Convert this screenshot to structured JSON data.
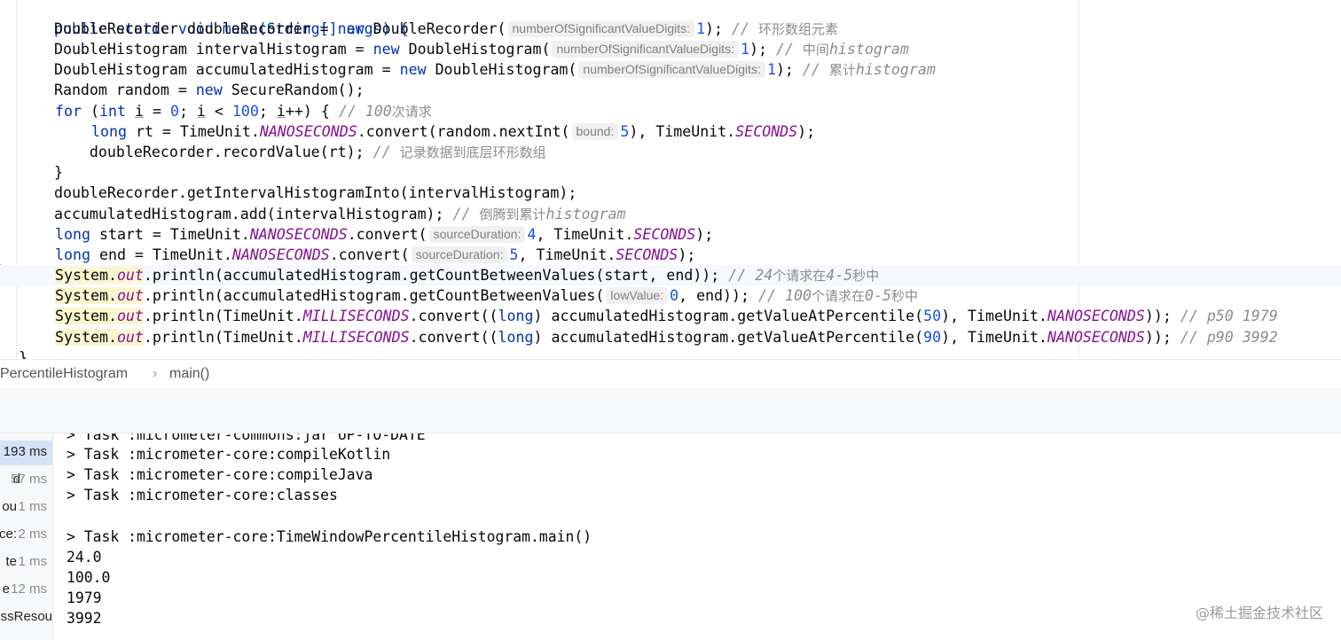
{
  "editor": {
    "lines": [
      {
        "text": "public static void main(String[] args) {"
      },
      {
        "a": "    DoubleRecorder doubleRecorder = ",
        "kw": "new",
        "b": " DoubleRecorder(",
        "hint": "numberOfSignificantValueDigits:",
        "num": "1",
        "c": ");",
        "cmt": " // ",
        "cjk": "环形数组元素"
      },
      {
        "a": "    DoubleHistogram intervalHistogram = ",
        "kw": "new",
        "b": " DoubleHistogram(",
        "hint": "numberOfSignificantValueDigits:",
        "num": "1",
        "c": ");",
        "cmt": " // ",
        "cjk": "中间",
        "cmt2": "histogram"
      },
      {
        "a": "    DoubleHistogram accumulatedHistogram = ",
        "kw": "new",
        "b": " DoubleHistogram(",
        "hint": "numberOfSignificantValueDigits:",
        "num": "1",
        "c": ");",
        "cmt": " // ",
        "cjk": "累计",
        "cmt2": "histogram"
      },
      {
        "a": "    Random random = ",
        "kw": "new",
        "b": " SecureRandom();"
      },
      {
        "kw1": "for",
        "a": " (",
        "kw2": "int",
        "b": " ",
        "u1": "i",
        "c": " = ",
        "num1": "0",
        "d": "; ",
        "u2": "i",
        "e": " < ",
        "num2": "100",
        "f": "; ",
        "u3": "i",
        "g": "++) { ",
        "cmt": "// 100",
        "cjk": "次请求"
      },
      {
        "kw": "long",
        "a": " rt = TimeUnit.",
        "field": "NANOSECONDS",
        "b": ".convert(random.nextInt(",
        "hint": "bound:",
        "num": "5",
        "c": "), TimeUnit.",
        "field2": "SECONDS",
        "d": ");"
      },
      {
        "a": "        doubleRecorder.recordValue(rt); ",
        "cmt": "// ",
        "cjk": "记录数据到底层环形数组"
      },
      {
        "a": "    }"
      },
      {
        "a": "    doubleRecorder.getIntervalHistogramInto(intervalHistogram);"
      },
      {
        "a": "    accumulatedHistogram.add(intervalHistogram); ",
        "cmt": "// ",
        "cjk": "倒腾到累计",
        "cmt2": "histogram"
      },
      {
        "kw": "long",
        "a": " start = TimeUnit.",
        "field": "NANOSECONDS",
        "b": ".convert(",
        "hint": "sourceDuration:",
        "num": "4",
        "c": ", TimeUnit.",
        "field2": "SECONDS",
        "d": ");"
      },
      {
        "kw": "long",
        "a": " end = TimeUnit.",
        "field": "NANOSECONDS",
        "b": ".convert(",
        "hint": "sourceDuration:",
        "num": "5",
        "c": ", TimeUnit.",
        "field2": "SECONDS",
        "d": ");"
      },
      {
        "sys": "System.",
        "out": "out",
        "a": ".println(accumulatedHistogram.getCountBetweenValues(start, end)); ",
        "cmt": "// 24",
        "cjk": "个请求在",
        "cmt2": "4-5",
        "cjk2": "秒中"
      },
      {
        "sys": "System.",
        "out": "out",
        "a": ".println(accumulatedHistogram.getCountBetweenValues(",
        "hint": "lowValue:",
        "num": "0",
        "b": ", end)); ",
        "cmt": "// 100",
        "cjk": "个请求在",
        "cmt2": "0-5",
        "cjk2": "秒中"
      },
      {
        "sys": "System.",
        "out": "out",
        "a": ".println(TimeUnit.",
        "field": "MILLISECONDS",
        "b": ".convert((",
        "kw": "long",
        "c": ") accumulatedHistogram.getValueAtPercentile(",
        "num": "50",
        "d": "), TimeUnit.",
        "field2": "NANOSECONDS",
        "e": ")); ",
        "cmt": "// p50 1979"
      },
      {
        "sys": "System.",
        "out": "out",
        "a": ".println(TimeUnit.",
        "field": "MILLISECONDS",
        "b": ".convert((",
        "kw": "long",
        "c": ") accumulatedHistogram.getValueAtPercentile(",
        "num": "90",
        "d": "), TimeUnit.",
        "field2": "NANOSECONDS",
        "e": ")); ",
        "cmt": "// p90 3992"
      }
    ],
    "closing_brace": "}"
  },
  "breadcrumb": {
    "class_name": "PercentileHistogram",
    "separator": "›",
    "method": "main()"
  },
  "build_tree": [
    {
      "name": "",
      "time": "193 ms",
      "selected": true
    },
    {
      "name": "d",
      "time": "57 ms",
      "selected": false
    },
    {
      "name": "ou",
      "time": "1 ms",
      "selected": false
    },
    {
      "name": "ce:",
      "time": "2 ms",
      "selected": false
    },
    {
      "name": "te",
      "time": "1 ms",
      "selected": false
    },
    {
      "name": "e",
      "time": "12 ms",
      "selected": false
    },
    {
      "name": "ssResou",
      "time": "",
      "selected": false
    }
  ],
  "console": {
    "lines": [
      "> Task :micrometer-commons:jar UP-TO-DATE",
      "> Task :micrometer-core:compileKotlin",
      "> Task :micrometer-core:compileJava",
      "> Task :micrometer-core:classes",
      "",
      "> Task :micrometer-core:TimeWindowPercentileHistogram.main()",
      "24.0",
      "100.0",
      "1979",
      "3992"
    ]
  },
  "watermark": "@稀土掘金技术社区",
  "colors": {
    "keyword": "#0033b3",
    "number": "#1750eb",
    "static_field": "#871094",
    "comment": "#8c8c8c",
    "current_line": "#f5f8fe",
    "selected_tree_row": "#d5e1f5"
  }
}
